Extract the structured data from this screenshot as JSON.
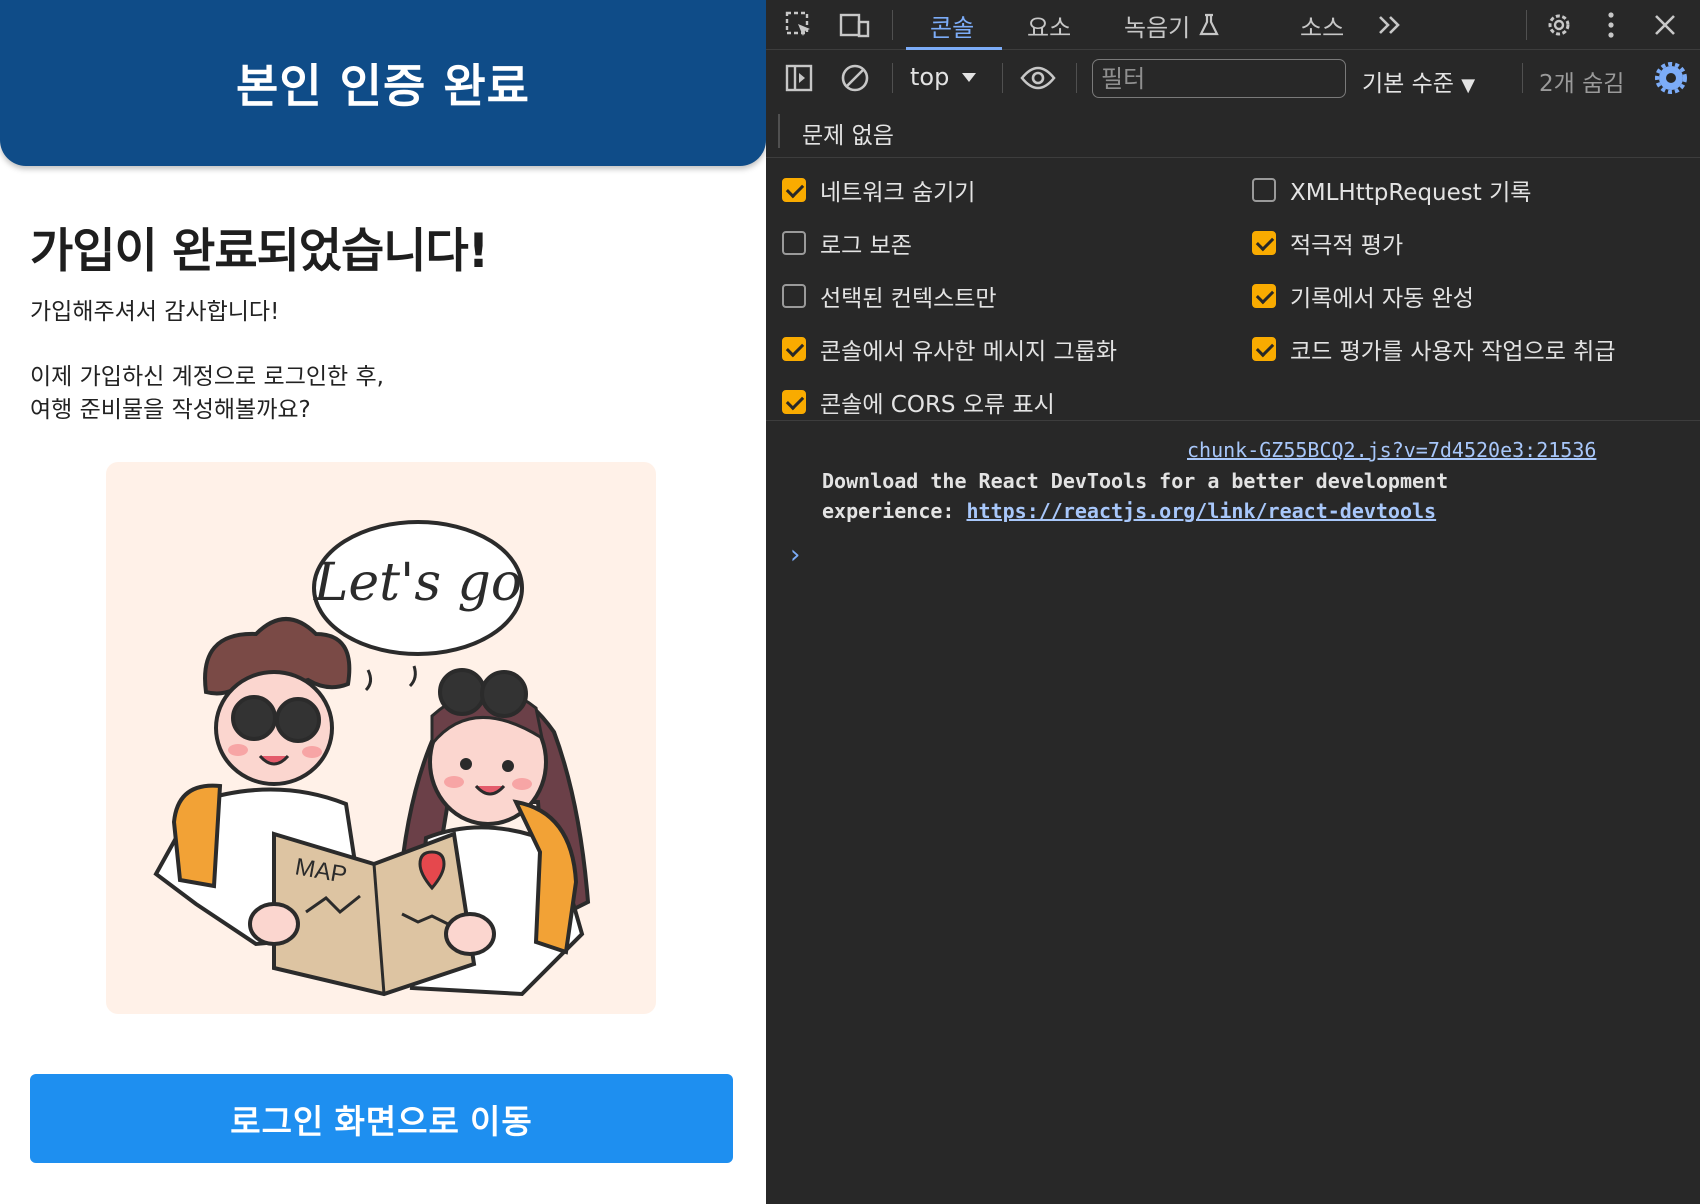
{
  "app": {
    "header_title": "본인 인증 완료",
    "heading": "가입이 완료되었습니다!",
    "thanks": "가입해주셔서 감사합니다!",
    "message_line1": "이제 가입하신 계정으로 로그인한 후,",
    "message_line2": "여행 준비물을 작성해볼까요?",
    "illustration": {
      "speech_text": "Let's go",
      "map_text": "MAP"
    },
    "cta_label": "로그인 화면으로 이동"
  },
  "devtools": {
    "tabs": [
      {
        "label": "콘솔",
        "active": true
      },
      {
        "label": "요소",
        "active": false
      },
      {
        "label": "녹음기",
        "active": false
      },
      {
        "label": "소스",
        "active": false
      }
    ],
    "toolbar": {
      "context": "top",
      "filter_placeholder": "필터",
      "levels": "기본 수준",
      "hidden_count": "2개 숨김"
    },
    "issues": "문제 없음",
    "settings": [
      {
        "label": "네트워크 숨기기",
        "checked": true
      },
      {
        "label": "XMLHttpRequest 기록",
        "checked": false
      },
      {
        "label": "로그 보존",
        "checked": false
      },
      {
        "label": "적극적 평가",
        "checked": true
      },
      {
        "label": "선택된 컨텍스트만",
        "checked": false
      },
      {
        "label": "기록에서 자동 완성",
        "checked": true
      },
      {
        "label": "콘솔에서 유사한 메시지 그룹화",
        "checked": true
      },
      {
        "label": "코드 평가를 사용자 작업으로 취급",
        "checked": true
      },
      {
        "label": "콘솔에 CORS 오류 표시",
        "checked": true
      }
    ],
    "console": {
      "source": "chunk-GZ55BCQ2.js?v=7d4520e3:21536",
      "message_line1": "Download the React DevTools for a better development",
      "message_prefix": "experience: ",
      "message_link": "https://reactjs.org/link/react-devtools",
      "prompt": "›"
    },
    "colors": {
      "accent": "#7cacf8",
      "checkbox": "#f9ab00",
      "background": "#282828"
    }
  }
}
